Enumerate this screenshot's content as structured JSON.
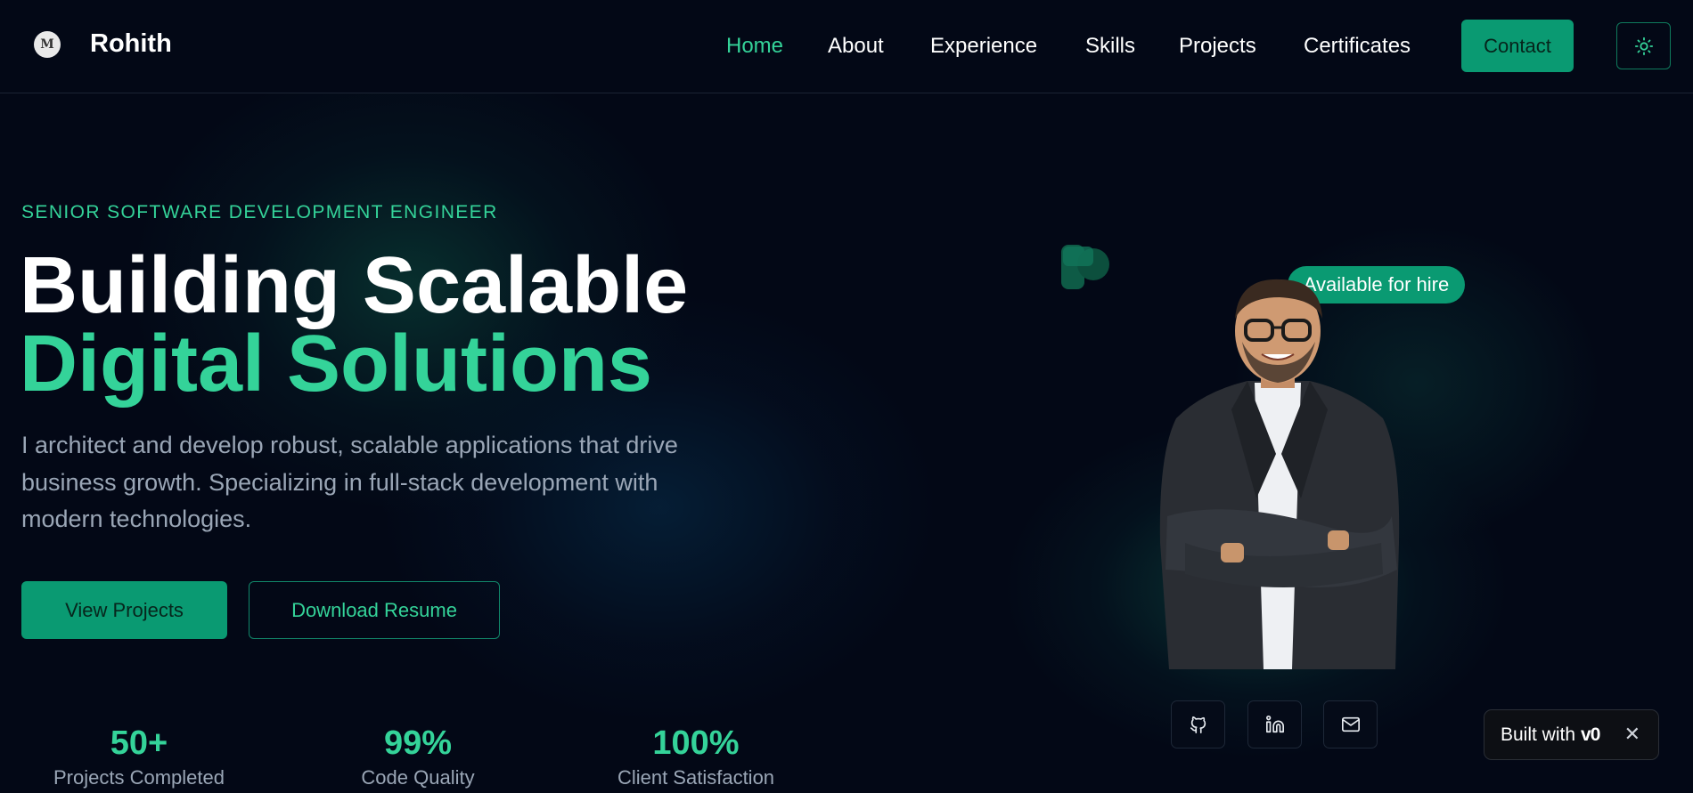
{
  "header": {
    "logo_text": "M",
    "brand": "Rohith",
    "nav": [
      {
        "label": "Home",
        "active": true
      },
      {
        "label": "About",
        "active": false
      },
      {
        "label": "Experience",
        "active": false
      },
      {
        "label": "Skills",
        "active": false
      },
      {
        "label": "Projects",
        "active": false
      },
      {
        "label": "Certificates",
        "active": false
      }
    ],
    "contact_label": "Contact",
    "theme_icon": "sun-icon"
  },
  "hero": {
    "eyebrow": "SENIOR SOFTWARE DEVELOPMENT ENGINEER",
    "title_line1": "Building Scalable",
    "title_line2": "Digital Solutions",
    "description": "I architect and develop robust, scalable applications that drive business growth. Specializing in full-stack development with modern technologies.",
    "primary_button": "View Projects",
    "secondary_button": "Download Resume",
    "stats": [
      {
        "value": "50+",
        "label": "Projects Completed"
      },
      {
        "value": "99%",
        "label": "Code Quality"
      },
      {
        "value": "100%",
        "label": "Client Satisfaction"
      }
    ]
  },
  "profile": {
    "availability_badge": "Available for hire",
    "social_icons": [
      "github-icon",
      "linkedin-icon",
      "mail-icon"
    ]
  },
  "v0_badge": {
    "text": "Built with",
    "brand": "v0",
    "close": "✕"
  },
  "colors": {
    "background": "#030816",
    "accent": "#34d399",
    "button": "#0a9a72",
    "muted_text": "#9aa6b6"
  }
}
